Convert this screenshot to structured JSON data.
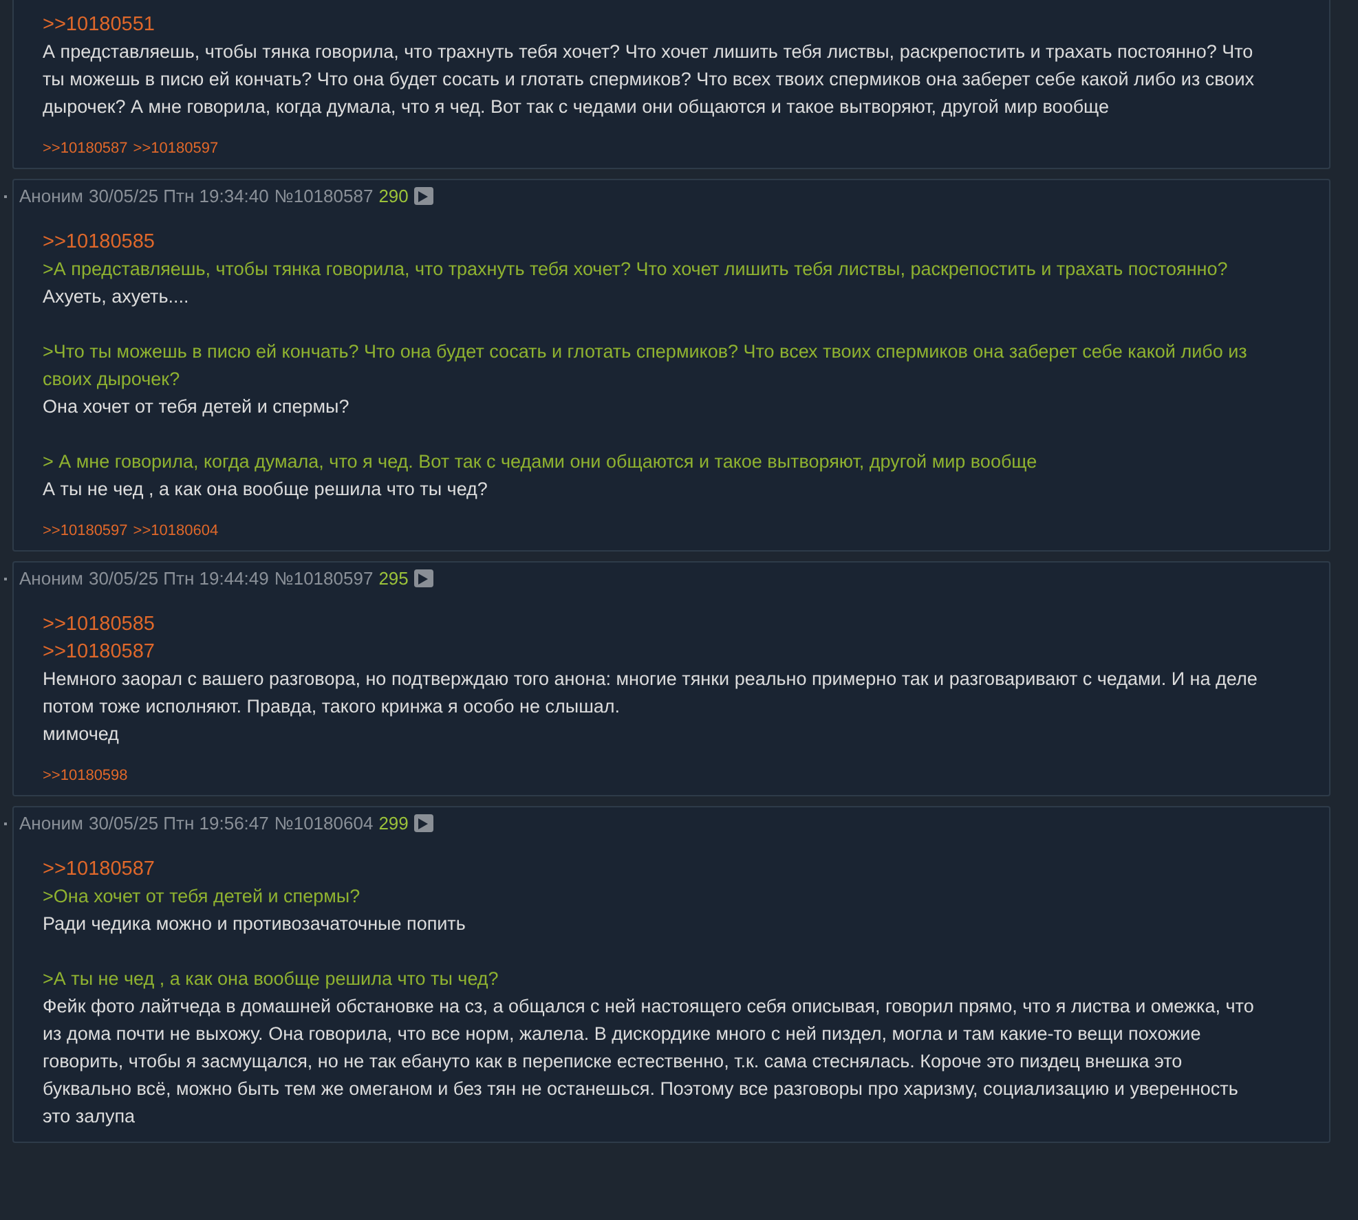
{
  "posts": [
    {
      "body": [
        {
          "kind": "link",
          "text": ">>10180551"
        },
        {
          "kind": "text",
          "text": "А представляешь, чтобы тянка говорила, что трахнуть тебя хочет? Что хочет лишить тебя листвы, раскрепостить и трахать постоянно? Что ты можешь в писю ей кончать? Что она будет сосать и глотать спермиков? Что всех твоих спермиков она заберет себе какой либо из своих дырочек? А мне говорила, когда думала, что я чед. Вот так с чедами они общаются и такое вытворяют, другой мир вообще"
        }
      ],
      "replies": [
        ">>10180587",
        ">>10180597"
      ]
    },
    {
      "header": {
        "name": "Аноним",
        "date": "30/05/25 Птн 19:34:40",
        "number": "№10180587",
        "count": "290"
      },
      "body": [
        {
          "kind": "link",
          "text": ">>10180585"
        },
        {
          "kind": "quote",
          "text": ">А представляешь, чтобы тянка говорила, что трахнуть тебя хочет? Что хочет лишить тебя листвы, раскрепостить и трахать постоянно?"
        },
        {
          "kind": "text",
          "text": "Ахуеть, ахуеть...."
        },
        {
          "kind": "gap"
        },
        {
          "kind": "quote",
          "text": ">Что ты можешь в писю ей кончать? Что она будет сосать и глотать спермиков? Что всех твоих спермиков она заберет себе какой либо из своих дырочек?"
        },
        {
          "kind": "text",
          "text": "Она хочет от тебя детей и спермы?"
        },
        {
          "kind": "gap"
        },
        {
          "kind": "quote",
          "text": "> А мне говорила, когда думала, что я чед. Вот так с чедами они общаются и такое вытворяют, другой мир вообще"
        },
        {
          "kind": "text",
          "text": "А ты не чед , а как она вообще решила что ты чед?"
        }
      ],
      "replies": [
        ">>10180597",
        ">>10180604"
      ]
    },
    {
      "header": {
        "name": "Аноним",
        "date": "30/05/25 Птн 19:44:49",
        "number": "№10180597",
        "count": "295"
      },
      "body": [
        {
          "kind": "link",
          "text": ">>10180585"
        },
        {
          "kind": "link",
          "text": ">>10180587"
        },
        {
          "kind": "text",
          "text": "Немного заорал с вашего разговора, но подтверждаю того анона: многие тянки реально примерно так и разговаривают с чедами. И на деле потом тоже исполняют. Правда, такого кринжа я особо не слышал."
        },
        {
          "kind": "text",
          "text": "мимочед"
        }
      ],
      "replies": [
        ">>10180598"
      ]
    },
    {
      "header": {
        "name": "Аноним",
        "date": "30/05/25 Птн 19:56:47",
        "number": "№10180604",
        "count": "299"
      },
      "body": [
        {
          "kind": "link",
          "text": ">>10180587"
        },
        {
          "kind": "quote",
          "text": ">Она хочет от тебя детей и спермы?"
        },
        {
          "kind": "text",
          "text": "Ради чедика можно и противозачаточные попить"
        },
        {
          "kind": "gap"
        },
        {
          "kind": "quote",
          "text": ">А ты не чед , а как она вообще решила что ты чед?"
        },
        {
          "kind": "text",
          "text": "Фейк фото лайтчеда в домашней обстановке на сз, а общался с ней настоящего себя описывая, говорил прямо, что я листва и омежка, что из дома почти не выхожу. Она говорила, что все норм, жалела. В дискордике много с ней пиздел, могла и там какие-то вещи похожие говорить, чтобы я засмущался, но не так ебануто как в переписке естественно, т.к. сама стеснялась. Короче это пиздец внешка это буквально всё, можно быть тем же омеганом и без тян не останешься. Поэтому все разговоры про харизму, социализацию и уверенность это залупа"
        }
      ]
    }
  ]
}
